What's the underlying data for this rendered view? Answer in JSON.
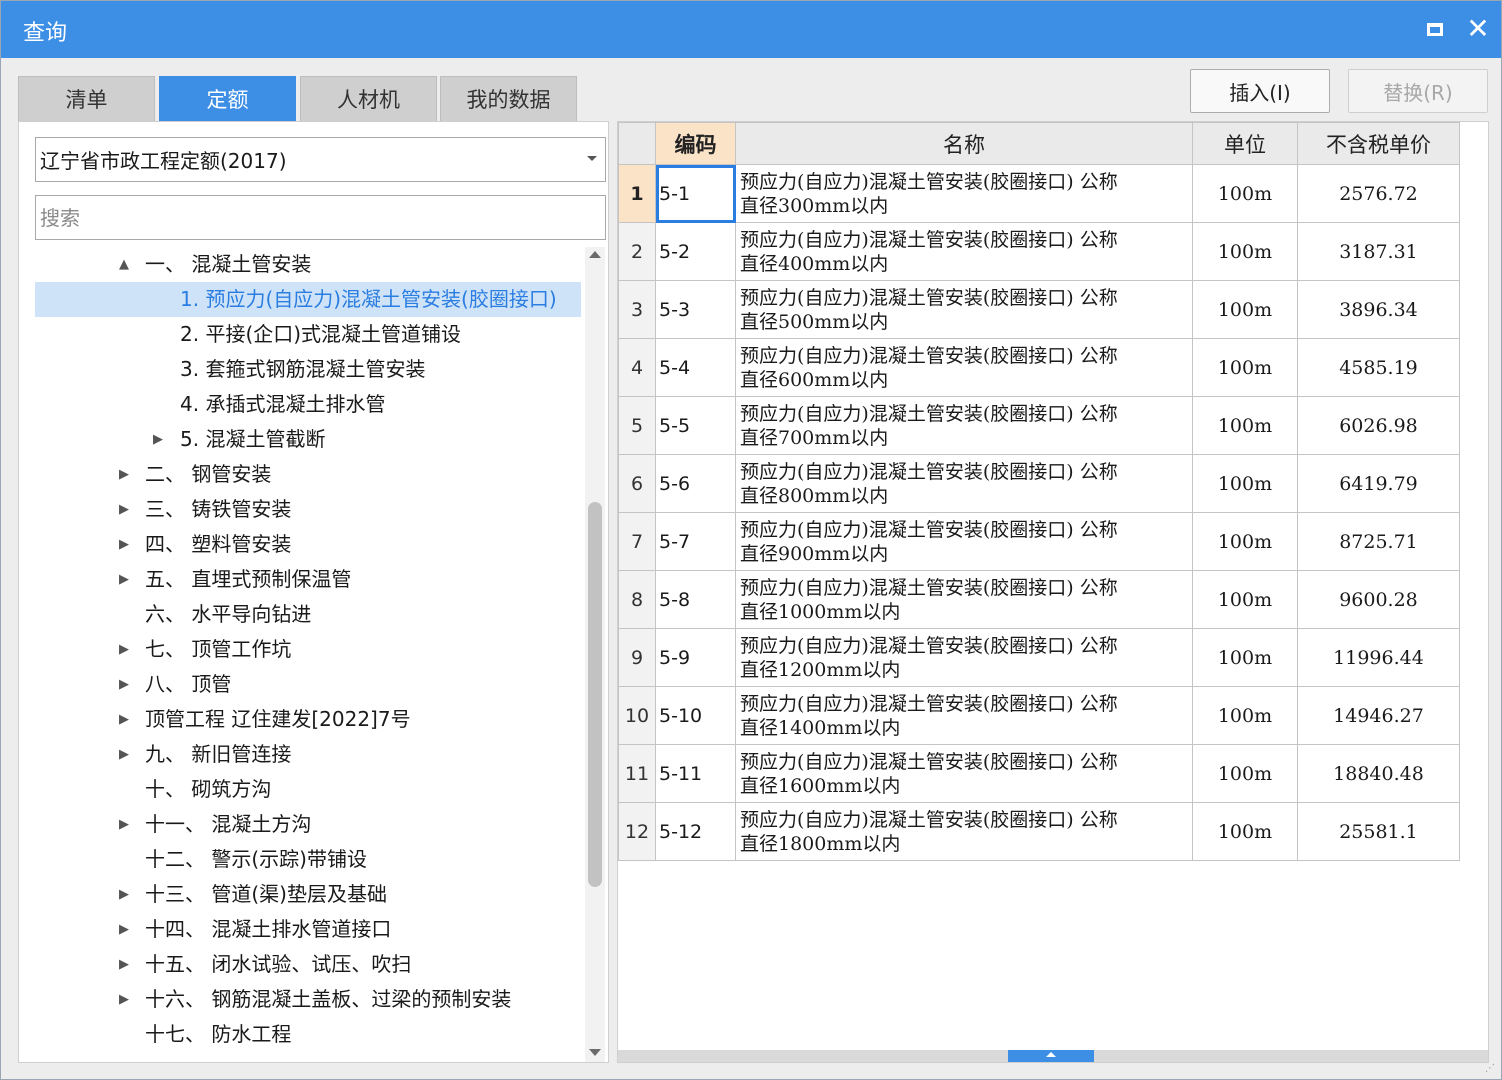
{
  "window": {
    "title": "查询",
    "maximize_icon": "maximize-icon",
    "close_glyph": "✕"
  },
  "tabs": [
    {
      "label": "清单",
      "active": false
    },
    {
      "label": "定额",
      "active": true
    },
    {
      "label": "人材机",
      "active": false
    },
    {
      "label": "我的数据",
      "active": false
    }
  ],
  "actions": {
    "insert_label": "插入(I)",
    "replace_label": "替换(R)",
    "replace_enabled": false
  },
  "library": {
    "selected": "辽宁省市政工程定额(2017)"
  },
  "search": {
    "placeholder": "搜索",
    "value": ""
  },
  "tree": [
    {
      "text": "一、 混凝土管安装",
      "level": 0,
      "toggle": "▲",
      "selected": false
    },
    {
      "text": "1. 预应力(自应力)混凝土管安装(胶圈接口)",
      "level": 1,
      "toggle": "",
      "selected": true
    },
    {
      "text": "2. 平接(企口)式混凝土管道铺设",
      "level": 1,
      "toggle": "",
      "selected": false
    },
    {
      "text": "3. 套箍式钢筋混凝土管安装",
      "level": 1,
      "toggle": "",
      "selected": false
    },
    {
      "text": "4. 承插式混凝土排水管",
      "level": 1,
      "toggle": "",
      "selected": false
    },
    {
      "text": "5. 混凝土管截断",
      "level": 1,
      "toggle": "▶",
      "selected": false
    },
    {
      "text": "二、 钢管安装",
      "level": 0,
      "toggle": "▶",
      "selected": false
    },
    {
      "text": "三、 铸铁管安装",
      "level": 0,
      "toggle": "▶",
      "selected": false
    },
    {
      "text": "四、 塑料管安装",
      "level": 0,
      "toggle": "▶",
      "selected": false
    },
    {
      "text": "五、 直埋式预制保温管",
      "level": 0,
      "toggle": "▶",
      "selected": false
    },
    {
      "text": "六、 水平导向钻进",
      "level": 0,
      "toggle": "",
      "selected": false
    },
    {
      "text": "七、 顶管工作坑",
      "level": 0,
      "toggle": "▶",
      "selected": false
    },
    {
      "text": "八、 顶管",
      "level": 0,
      "toggle": "▶",
      "selected": false
    },
    {
      "text": "顶管工程 辽住建发[2022]7号",
      "level": 0,
      "toggle": "▶",
      "selected": false
    },
    {
      "text": "九、 新旧管连接",
      "level": 0,
      "toggle": "▶",
      "selected": false
    },
    {
      "text": "十、 砌筑方沟",
      "level": 0,
      "toggle": "",
      "selected": false
    },
    {
      "text": "十一、 混凝土方沟",
      "level": 0,
      "toggle": "▶",
      "selected": false
    },
    {
      "text": "十二、 警示(示踪)带铺设",
      "level": 0,
      "toggle": "",
      "selected": false
    },
    {
      "text": "十三、 管道(渠)垫层及基础",
      "level": 0,
      "toggle": "▶",
      "selected": false
    },
    {
      "text": "十四、 混凝土排水管道接口",
      "level": 0,
      "toggle": "▶",
      "selected": false
    },
    {
      "text": "十五、 闭水试验、试压、吹扫",
      "level": 0,
      "toggle": "▶",
      "selected": false
    },
    {
      "text": "十六、 钢筋混凝土盖板、过梁的预制安装",
      "level": 0,
      "toggle": "▶",
      "selected": false
    },
    {
      "text": "十七、 防水工程",
      "level": 0,
      "toggle": "",
      "selected": false
    }
  ],
  "grid": {
    "headers": [
      "",
      "编码",
      "名称",
      "单位",
      "不含税单价"
    ],
    "rows": [
      {
        "no": "1",
        "code": "5-1",
        "name1": "预应力(自应力)混凝土管安装(胶圈接口) 公称",
        "name2": "直径300mm以内",
        "unit": "100m",
        "price": "2576.72"
      },
      {
        "no": "2",
        "code": "5-2",
        "name1": "预应力(自应力)混凝土管安装(胶圈接口) 公称",
        "name2": "直径400mm以内",
        "unit": "100m",
        "price": "3187.31"
      },
      {
        "no": "3",
        "code": "5-3",
        "name1": "预应力(自应力)混凝土管安装(胶圈接口) 公称",
        "name2": "直径500mm以内",
        "unit": "100m",
        "price": "3896.34"
      },
      {
        "no": "4",
        "code": "5-4",
        "name1": "预应力(自应力)混凝土管安装(胶圈接口) 公称",
        "name2": "直径600mm以内",
        "unit": "100m",
        "price": "4585.19"
      },
      {
        "no": "5",
        "code": "5-5",
        "name1": "预应力(自应力)混凝土管安装(胶圈接口) 公称",
        "name2": "直径700mm以内",
        "unit": "100m",
        "price": "6026.98"
      },
      {
        "no": "6",
        "code": "5-6",
        "name1": "预应力(自应力)混凝土管安装(胶圈接口) 公称",
        "name2": "直径800mm以内",
        "unit": "100m",
        "price": "6419.79"
      },
      {
        "no": "7",
        "code": "5-7",
        "name1": "预应力(自应力)混凝土管安装(胶圈接口) 公称",
        "name2": "直径900mm以内",
        "unit": "100m",
        "price": "8725.71"
      },
      {
        "no": "8",
        "code": "5-8",
        "name1": "预应力(自应力)混凝土管安装(胶圈接口) 公称",
        "name2": "直径1000mm以内",
        "unit": "100m",
        "price": "9600.28"
      },
      {
        "no": "9",
        "code": "5-9",
        "name1": "预应力(自应力)混凝土管安装(胶圈接口) 公称",
        "name2": "直径1200mm以内",
        "unit": "100m",
        "price": "11996.44"
      },
      {
        "no": "10",
        "code": "5-10",
        "name1": "预应力(自应力)混凝土管安装(胶圈接口) 公称",
        "name2": "直径1400mm以内",
        "unit": "100m",
        "price": "14946.27"
      },
      {
        "no": "11",
        "code": "5-11",
        "name1": "预应力(自应力)混凝土管安装(胶圈接口) 公称",
        "name2": "直径1600mm以内",
        "unit": "100m",
        "price": "18840.48"
      },
      {
        "no": "12",
        "code": "5-12",
        "name1": "预应力(自应力)混凝土管安装(胶圈接口) 公称",
        "name2": "直径1800mm以内",
        "unit": "100m",
        "price": "25581.1"
      }
    ],
    "current_row": 0
  },
  "colors": {
    "accent": "#3d8fe6",
    "selected_row_bg": "#cfe3f8",
    "current_header_bg": "#fbe3c8"
  }
}
